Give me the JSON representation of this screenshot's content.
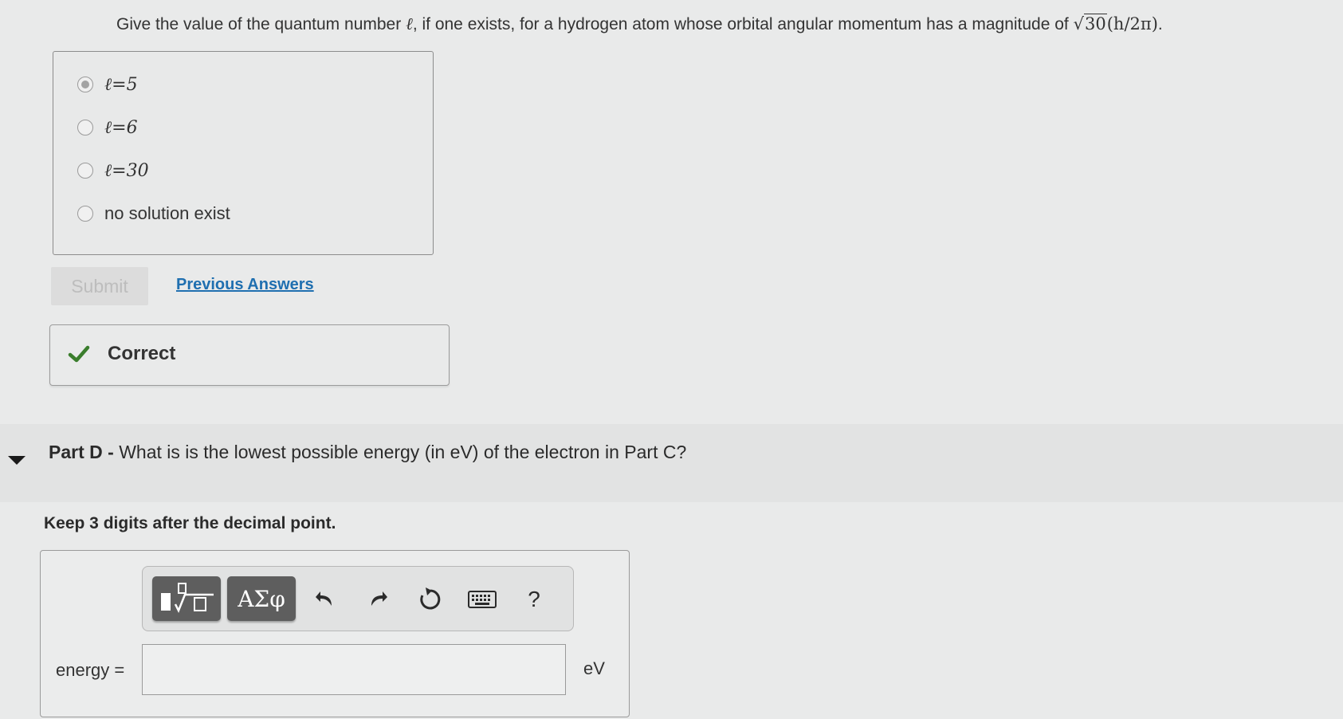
{
  "question": {
    "text": "Give the value of the quantum number",
    "symbol": "ℓ",
    "text_after": ", if one exists, for a hydrogen atom whose orbital angular momentum has a magnitude of",
    "sqrt_value": "30",
    "h_expr": "(h/2π)",
    "end": "."
  },
  "choices": [
    {
      "label": "ℓ=5",
      "selected": true
    },
    {
      "label": "ℓ=6",
      "selected": false
    },
    {
      "label": "ℓ=30",
      "selected": false
    },
    {
      "label": "no solution exist",
      "selected": false
    }
  ],
  "submit_label": "Submit",
  "previous_answers_label": "Previous Answers",
  "feedback": {
    "label": "Correct",
    "color": "#3a7d2c"
  },
  "part_d": {
    "prefix": "Part D -",
    "text": "What is is the lowest possible energy (in eV) of the electron in Part C?"
  },
  "instruction": "Keep 3 digits after the decimal point.",
  "toolbar": {
    "templates_icon": "templates-icon",
    "greek_label": "ΑΣφ",
    "undo_icon": "undo-icon",
    "redo_icon": "redo-icon",
    "reset_icon": "reset-icon",
    "keyboard_icon": "keyboard-icon",
    "help_label": "?"
  },
  "answer": {
    "label": "energy =",
    "value": "",
    "unit": "eV"
  }
}
